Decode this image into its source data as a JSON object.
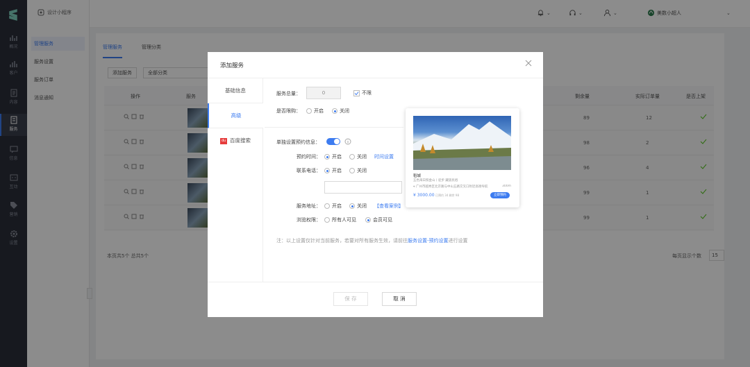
{
  "app": {
    "name": "设计小程序"
  },
  "sidebar": {
    "items": [
      {
        "label": "概况"
      },
      {
        "label": "客户"
      },
      {
        "label": "内容"
      },
      {
        "label": "服务"
      },
      {
        "label": "信息"
      },
      {
        "label": "互动"
      },
      {
        "label": "营销"
      },
      {
        "label": "设置"
      }
    ]
  },
  "submenu": {
    "items": [
      {
        "label": "管理服务"
      },
      {
        "label": "服务设置"
      },
      {
        "label": "服务订单"
      },
      {
        "label": "消息通知"
      }
    ]
  },
  "topbar": {
    "user": "美数小超人"
  },
  "main": {
    "tabs": [
      {
        "label": "管理服务"
      },
      {
        "label": "管理分类"
      }
    ],
    "add_button": "添加服务",
    "category_select": "全部分类",
    "columns": {
      "op": "操作",
      "service": "服务",
      "remain": "剩余量",
      "orders": "实际订单量",
      "online": "是否上架"
    },
    "rows": [
      {
        "remain": "89",
        "orders": "12"
      },
      {
        "remain": "98",
        "orders": "2"
      },
      {
        "remain": "96",
        "orders": "4"
      },
      {
        "remain": "99",
        "orders": "1"
      },
      {
        "remain": "99",
        "orders": "1"
      }
    ],
    "footer_left": "本页共5个  总共5个",
    "per_page_label": "每页显示个数",
    "per_page_value": "15"
  },
  "modal": {
    "title": "添加服务",
    "nav": [
      {
        "label": "基础信息"
      },
      {
        "label": "高级"
      },
      {
        "label": "百度搜索"
      }
    ],
    "baidu_badge": "du",
    "quantity_label": "服务总量：",
    "quantity_value": "0",
    "unlimited_label": "不限",
    "limit_label": "是否限购：",
    "opt_on": "开启",
    "opt_off": "关闭",
    "booking_label": "单独设置预约信息：",
    "booking_time_label": "预约时间：",
    "time_setting_link": "时间设置",
    "phone_label": "联系电话：",
    "address_label": "服务地址：",
    "view_example_link": "【查看案例】",
    "access_label": "浏览权限：",
    "access_all": "所有人可见",
    "access_member": "会员可见",
    "note_prefix": "注：以上设置仅针对当前服务，若要对所有服务生效，请前往",
    "note_link": "服务设置-预约设置",
    "note_suffix": "进行设置",
    "save_button": "保 存",
    "cancel_button": "取 消"
  },
  "preview": {
    "title": "稻城",
    "subtitle": "五色海日照金山丨徒步 藏族民俗",
    "address": "广州市越秀区北京路与中山五路交叉口附近高德导航",
    "distance": "300m",
    "price": "¥ 3000.00",
    "meta": "已预约 34  剩余 98",
    "button": "立即预约"
  },
  "colors": {
    "accent": "#3d7cf0",
    "sidebar": "#2b2f3a"
  }
}
